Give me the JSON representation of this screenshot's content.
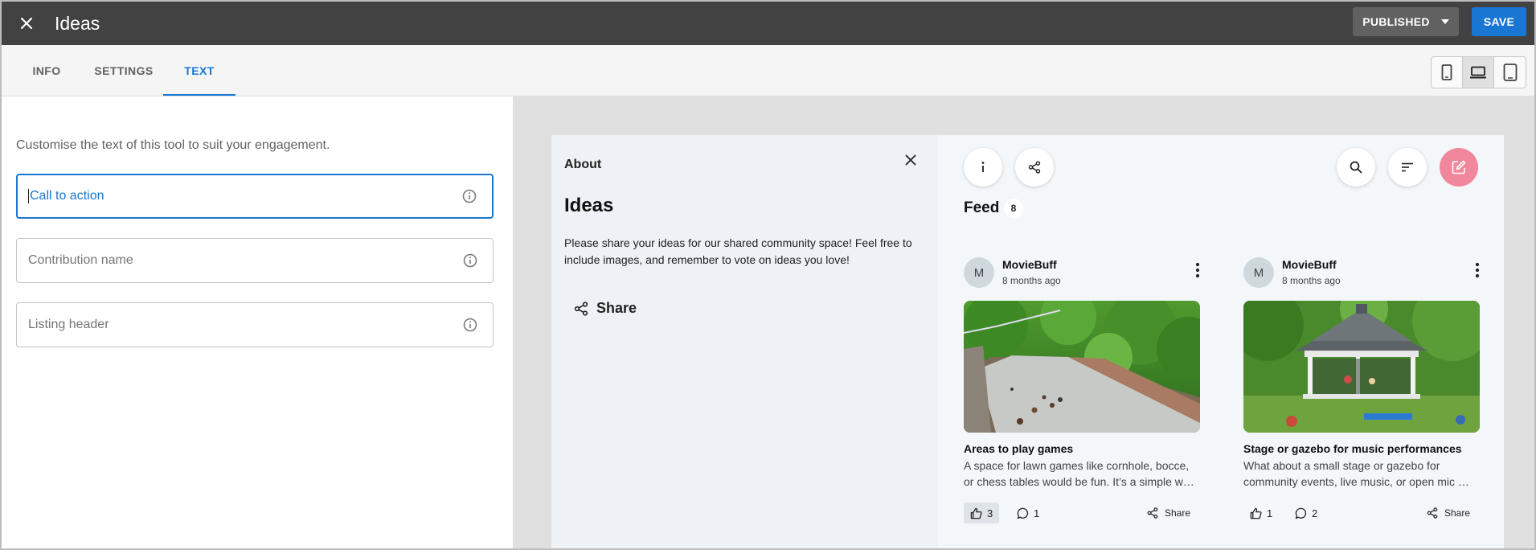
{
  "header": {
    "title": "Ideas",
    "status_label": "PUBLISHED",
    "save_label": "SAVE"
  },
  "tabs": [
    {
      "label": "INFO",
      "active": false
    },
    {
      "label": "SETTINGS",
      "active": false
    },
    {
      "label": "TEXT",
      "active": true
    }
  ],
  "device_toggle": {
    "options": [
      "mobile-icon",
      "laptop-icon",
      "tablet-icon"
    ],
    "selected": "laptop-icon"
  },
  "text_panel": {
    "intro": "Customise the text of this tool to suit your engagement.",
    "fields": [
      {
        "placeholder": "Call to action",
        "value": "",
        "focused": true
      },
      {
        "placeholder": "Contribution name",
        "value": "",
        "focused": false
      },
      {
        "placeholder": "Listing header",
        "value": "",
        "focused": false
      }
    ]
  },
  "about": {
    "label": "About",
    "title": "Ideas",
    "description": "Please share your ideas for our shared community space! Feel free to include images, and remember to vote on ideas you love!",
    "share_label": "Share"
  },
  "feed": {
    "title": "Feed",
    "count": "8",
    "cards": [
      {
        "avatar_initial": "M",
        "author": "MovieBuff",
        "time": "8 months ago",
        "title": "Areas to play games",
        "desc_line1": "A space for lawn games like cornhole, bocce,",
        "desc_line2": "or chess tables would be fun. It’s a simple wa…",
        "likes": "3",
        "comments": "1",
        "liked": true,
        "share_label": "Share"
      },
      {
        "avatar_initial": "M",
        "author": "MovieBuff",
        "time": "8 months ago",
        "title": "Stage or gazebo for music performances",
        "desc_line1": "What about a small stage or gazebo for",
        "desc_line2": "community events, live music, or open mic …",
        "likes": "1",
        "comments": "2",
        "liked": false,
        "share_label": "Share"
      }
    ]
  },
  "colors": {
    "topbar": "#424242",
    "accent": "#1976d2",
    "create_button": "#f0879c"
  }
}
